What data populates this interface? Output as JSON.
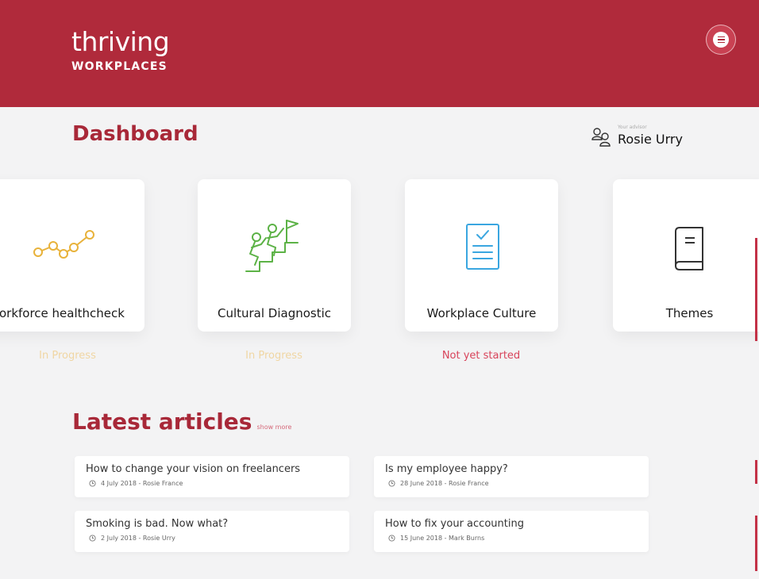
{
  "brand": {
    "name": "thriving",
    "subtitle": "WORKPLACES"
  },
  "page": {
    "title": "Dashboard"
  },
  "user": {
    "caption": "Your advisor",
    "name": "Rosie Urry"
  },
  "cards": [
    {
      "label": "Workforce healthcheck",
      "status": "In Progress",
      "icon": "connected-dots-chart-icon"
    },
    {
      "label": "Cultural Diagnostic",
      "status": "In Progress",
      "icon": "climbing-team-flag-icon"
    },
    {
      "label": "Workplace Culture",
      "status": "Not yet started",
      "icon": "checklist-clipboard-icon"
    },
    {
      "label": "Themes",
      "status": "",
      "icon": "book-icon"
    }
  ],
  "articles_section": {
    "title": "Latest articles",
    "show_more": "show more"
  },
  "articles": [
    {
      "title": "How to change your vision on freelancers",
      "meta": "4 July 2018 - Rosie France"
    },
    {
      "title": "Is my employee happy?",
      "meta": "28 June 2018 - Rosie France"
    },
    {
      "title": "Smoking is bad. Now what?",
      "meta": "2 July 2018 - Rosie Urry"
    },
    {
      "title": "How to fix your accounting",
      "meta": "15 June 2018 - Mark Burns"
    }
  ],
  "colors": {
    "brand_red": "#b02a3b",
    "title_red": "#a82838",
    "status_red": "#d8435a",
    "icon_gold": "#e8b23a",
    "icon_green": "#5cb246",
    "icon_blue": "#3aa6e0"
  }
}
